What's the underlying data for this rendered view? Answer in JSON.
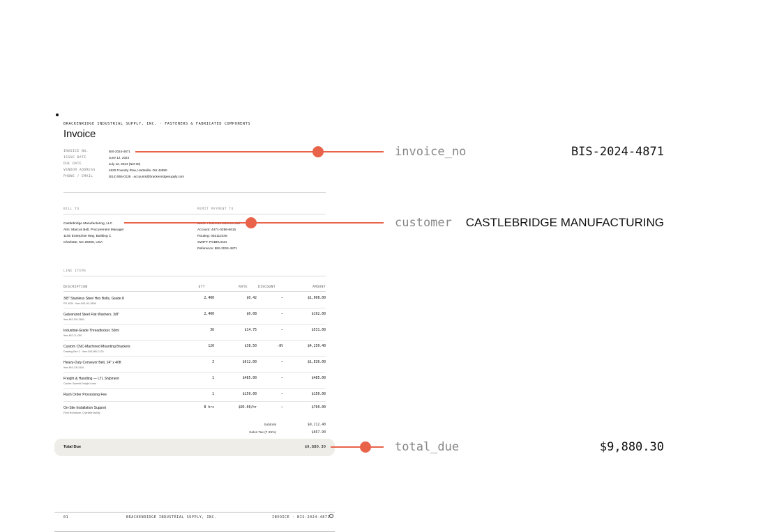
{
  "company_line": "BRACKENRIDGE INDUSTRIAL SUPPLY, INC. · FASTENERS & FABRICATED COMPONENTS",
  "title": "Invoice",
  "meta": [
    {
      "k": "INVOICE NO.",
      "v": "BIS-2024-4871"
    },
    {
      "k": "ISSUE DATE",
      "v": "June 12, 2024"
    },
    {
      "k": "DUE DATE",
      "v": "July 12, 2024 (Net 30)"
    },
    {
      "k": "VENDOR ADDRESS",
      "v": "4820 Foundry Row, Hartsville, OH 44890"
    },
    {
      "k": "PHONE / EMAIL",
      "v": "(614) 555-0138 · accounts@brackenridgesupply.com"
    }
  ],
  "bill_to": {
    "label": "BILL TO",
    "lines": [
      "Castlebridge Manufacturing, LLC",
      "Attn: Marcus Bell, Procurement Manager",
      "1150 Enterprise Way, Building C",
      "Charlotte, NC 28206, USA"
    ]
  },
  "remit": {
    "label": "REMIT PAYMENT TO",
    "lines": [
      "Bank: Piedmont Commercial",
      "Account: 4471-0298-6615",
      "Routing: 053112345",
      "SWIFT: PCBKUS44",
      "Reference: BIS-2024-4871"
    ]
  },
  "line_items_label": "LINE ITEMS",
  "columns": {
    "description": "DESCRIPTION",
    "qty": "QTY",
    "rate": "RATE",
    "discount": "DISCOUNT",
    "amount": "AMOUNT"
  },
  "items": [
    {
      "desc": "3/8\" Stainless Steel Hex Bolts, Grade 8",
      "sub": "PO 4520 · Item BIS-HX-3808",
      "qty": "2,400",
      "rate": "$0.42",
      "disc": "—",
      "amt": "$1,008.00"
    },
    {
      "desc": "Galvanized Steel Flat Washers, 3/8\"",
      "sub": "Item BIS-FW-3800",
      "qty": "2,400",
      "rate": "$0.08",
      "disc": "—",
      "amt": "$192.00"
    },
    {
      "desc": "Industrial-Grade Threadlocker, 50ml",
      "sub": "Item BIS-TL-050",
      "qty": "36",
      "rate": "$14.75",
      "disc": "—",
      "amt": "$531.00"
    },
    {
      "desc": "Custom CNC-Machined Mounting Brackets",
      "sub": "Drawing Rev C · Item BIS-MB-C120",
      "qty": "120",
      "rate": "$38.50",
      "disc": "-8%",
      "amt": "$4,250.40"
    },
    {
      "desc": "Heavy-Duty Conveyor Belt, 24\" x 40ft",
      "sub": "Item BIS-CB-2440",
      "qty": "3",
      "rate": "$612.00",
      "disc": "—",
      "amt": "$1,836.00"
    },
    {
      "desc": "Freight & Handling — LTL Shipment",
      "sub": "Carrier: Summit Freight Lines",
      "qty": "1",
      "rate": "$485.00",
      "disc": "—",
      "amt": "$485.00"
    },
    {
      "desc": "Rush Order Processing Fee",
      "sub": "",
      "qty": "1",
      "rate": "$150.00",
      "disc": "—",
      "amt": "$150.00"
    },
    {
      "desc": "On-Site Installation Support",
      "sub": "Field technician, Charlotte facility",
      "qty": "8 hrs",
      "rate": "$95.00/hr",
      "disc": "—",
      "amt": "$760.00"
    }
  ],
  "subtotal": {
    "label": "Subtotal",
    "value": "$9,212.40"
  },
  "tax": {
    "label": "Sales Tax (7.25%)",
    "value": "$667.90"
  },
  "total": {
    "label": "Total Due",
    "value": "$9,880.30"
  },
  "footer": {
    "page": "01",
    "company": "BRACKENRIDGE INDUSTRIAL SUPPLY, INC.",
    "ref": "INVOICE · BIS-2024-4871"
  },
  "callouts": [
    {
      "key": "invoice_no",
      "value": "BIS-2024-4871"
    },
    {
      "key": "customer",
      "value": "CASTLEBRIDGE MANUFACTURING"
    },
    {
      "key": "total_due",
      "value": "$9,880.30"
    }
  ],
  "colors": {
    "accent": "#e8634a",
    "total_bar": "#efede8"
  }
}
